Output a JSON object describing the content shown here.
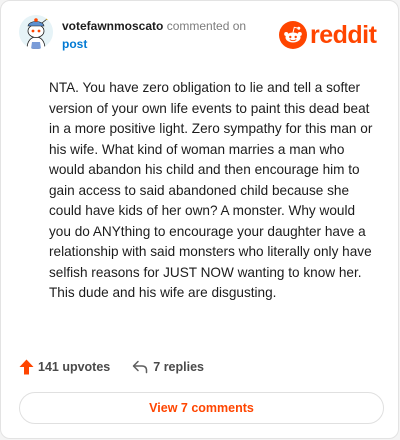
{
  "header": {
    "author": "votefawnmoscato",
    "action_text": "commented on",
    "post_link": "post",
    "logo_text": "reddit"
  },
  "comment": {
    "body": "NTA. You have zero obligation to lie and tell a softer version of your own life events to paint this dead beat in a more positive light. Zero sympathy for this man or his wife. What kind of woman marries a man who would abandon his child and then encourage him to gain access to said abandoned child because she could have kids of her own? A monster. Why would you do ANYthing to encourage your daughter have a relationship with said monsters who literally only have selfish reasons for JUST NOW wanting to know her. This dude and his wife are disgusting."
  },
  "actions": {
    "upvotes": "141 upvotes",
    "replies": "7 replies"
  },
  "footer": {
    "view_comments": "View 7 comments"
  },
  "colors": {
    "brand": "#ff4500",
    "link": "#0079d3"
  },
  "icons": [
    "snoo-avatar-icon",
    "reddit-logo-icon",
    "upvote-arrow-icon",
    "reply-arrow-icon"
  ]
}
